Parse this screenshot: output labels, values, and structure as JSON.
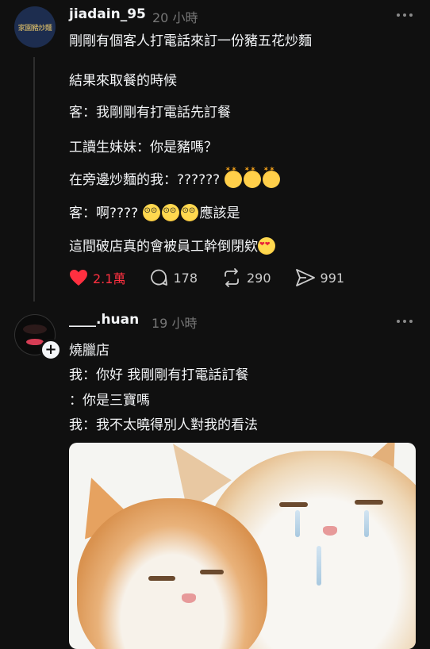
{
  "post1": {
    "username": "jiadain_95",
    "time": "20 小時",
    "avatar_text": "家園豬炒麵",
    "lines": [
      "剛剛有個客人打電話來訂一份豬五花炒麵",
      "結果來取餐的時候",
      "客：我剛剛有打電話先訂餐",
      "工讀生妹妹：你是豬嗎？",
      "在旁邊炒麵的我：??????",
      "客：啊????",
      "應該是",
      "這間破店真的會被員工幹倒閉欸"
    ],
    "likes": "2.1萬",
    "comments": "178",
    "reposts": "290",
    "shares": "991"
  },
  "post2": {
    "username": "____.huan",
    "time": "19 小時",
    "lines": [
      "燒臘店",
      "我：你好 我剛剛有打電話訂餐",
      "：你是三寶嗎",
      "我：我不太曉得別人對我的看法"
    ]
  },
  "icons": {
    "like": "heart-filled-icon",
    "comment": "comment-bubble-icon",
    "repost": "repost-icon",
    "share": "send-icon",
    "more": "more-horizontal-icon",
    "follow": "plus-icon"
  },
  "colors": {
    "like": "#ff3040",
    "background": "#101010",
    "muted": "#777777"
  }
}
